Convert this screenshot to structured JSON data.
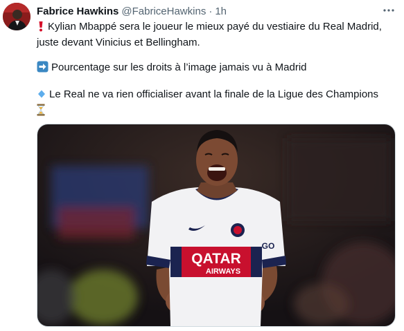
{
  "author": {
    "name": "Fabrice Hawkins",
    "handle": "@FabriceHawkins",
    "separator": "·",
    "time": "1h"
  },
  "icons": {
    "more": "more-horizontal-icon",
    "line1": "heavy-exclamation-mark-icon",
    "line2": "right-arrow-button-icon",
    "line3": "small-blue-diamond-icon",
    "line4": "hourglass-icon"
  },
  "tweet": {
    "line1a": "Kylian Mbappé sera le joueur le mieux payé du vestiaire du Real Madrid,",
    "line1b": "juste devant Vinicius et Bellingham.",
    "line2": "Pourcentage sur les droits à l’image jamais vu à Madrid",
    "line3": "Le Real ne va rien officialiser avant la finale de la Ligue des Champions"
  },
  "media": {
    "jersey_sponsor_line1": "QATAR",
    "jersey_sponsor_line2": "AIRWAYS",
    "jersey_text": "GO"
  },
  "colors": {
    "jersey_white": "#f2f2f4",
    "jersey_navy": "#1b2350",
    "jersey_red": "#c8102e",
    "emoji_red": "#d6102a",
    "emoji_blue": "#3b88c3"
  }
}
